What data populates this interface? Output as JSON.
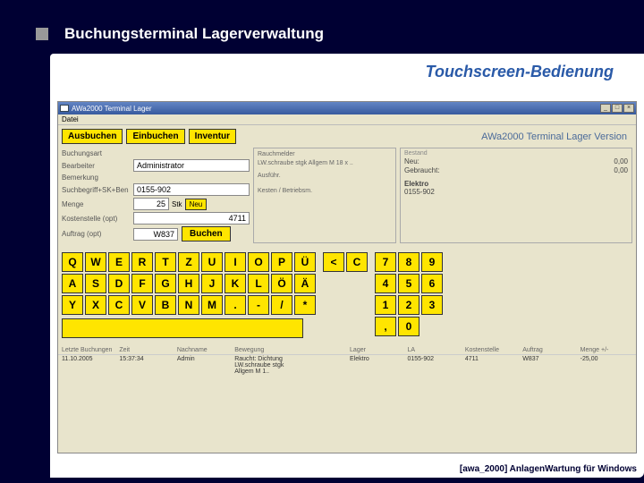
{
  "slide": {
    "title": "Buchungsterminal Lagerverwaltung",
    "subtitle": "Touchscreen-Bedienung",
    "footer": "[awa_2000]  AnlagenWartung für Windows"
  },
  "window": {
    "title": "AWa2000 Terminal Lager",
    "menu": "Datei",
    "version": "AWa2000 Terminal Lager Version"
  },
  "toolbar": {
    "ausbuchen": "Ausbuchen",
    "einbuchen": "Einbuchen",
    "inventur": "Inventur"
  },
  "form": {
    "label_buchungsart": "Buchungsart",
    "label_bearbeiter": "Bearbeiter",
    "value_bearbeiter": "Administrator",
    "label_bemerkung": "Bemerkung",
    "label_suchbegriff": "Suchbegriff+SK+Ben",
    "value_suchbegriff": "0155-902",
    "label_menge": "Menge",
    "value_menge": "25",
    "unit": "Stk",
    "btn_neu": "Neu",
    "label_kostenstelle": "Kostenstelle (opt)",
    "value_kostenstelle": "4711",
    "label_auftrag": "Auftrag (opt)",
    "value_auftrag": "W837",
    "btn_buchen": "Buchen"
  },
  "mid": {
    "line1": "Rauchmelder",
    "line2": "LW.schraube stgk Allgem  M 18 x ..",
    "line3": "Ausführ.",
    "line4": "Kesten / Betriebsm."
  },
  "right": {
    "header": "Bestand",
    "neu_label": "Neu:",
    "neu_value": "0,00",
    "gebraucht_label": "Gebraucht:",
    "gebraucht_value": "0,00",
    "stock_name": "Elektro",
    "stock_code": "0155-902"
  },
  "keyboard": {
    "row1": [
      "Q",
      "W",
      "E",
      "R",
      "T",
      "Z",
      "U",
      "I",
      "O",
      "P",
      "Ü"
    ],
    "row2": [
      "A",
      "S",
      "D",
      "F",
      "G",
      "H",
      "J",
      "K",
      "L",
      "Ö",
      "Ä"
    ],
    "row3": [
      "Y",
      "X",
      "C",
      "V",
      "B",
      "N",
      "M",
      ".",
      "-",
      "/",
      "*"
    ],
    "nav": [
      "<",
      "C"
    ],
    "num1": [
      "7",
      "8",
      "9"
    ],
    "num2": [
      "4",
      "5",
      "6"
    ],
    "num3": [
      "1",
      "2",
      "3"
    ],
    "num4": [
      ",",
      "0"
    ]
  },
  "grid": {
    "headers": [
      "Letzte Buchungen",
      "Zeit",
      "Nachname",
      "Bewegung",
      "",
      "Lager",
      "LA",
      "Kostenstelle",
      "Auftrag",
      "Menge +/-"
    ],
    "row1": [
      "11.10.2005",
      "15:37:34",
      "Admin",
      "Raucht: Dichtung LW.schraube stgk Allgem M 1..",
      "",
      "Elektro",
      "0155-902",
      "4711",
      "W837",
      "-25,00"
    ]
  }
}
